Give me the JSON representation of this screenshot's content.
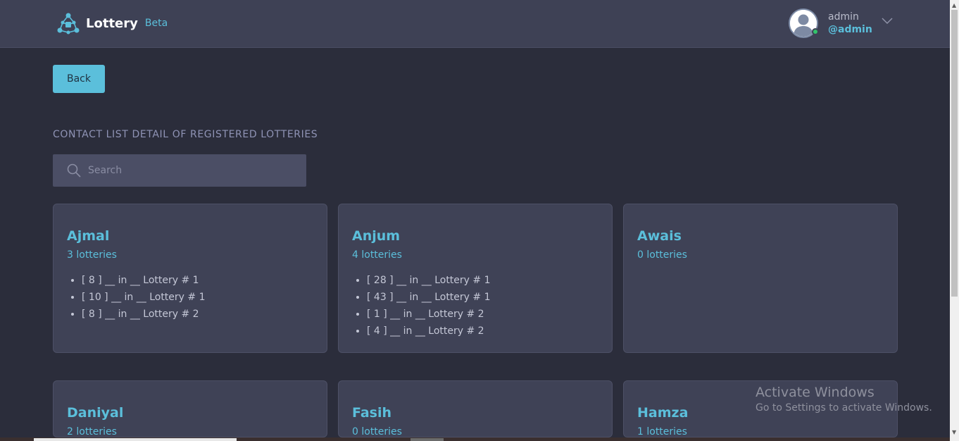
{
  "header": {
    "brand_name": "Lottery",
    "brand_badge": "Beta",
    "logo_icon": "network-logo-icon",
    "user": {
      "name": "admin",
      "handle": "@admin",
      "status": "online"
    }
  },
  "back_label": "Back",
  "section_title": "CONTACT LIST DETAIL OF REGISTERED LOTTERIES",
  "search": {
    "placeholder": "Search",
    "value": ""
  },
  "contacts": [
    {
      "name": "Ajmal",
      "count": "3 lotteries",
      "items": [
        "[ 8 ] __ in __ Lottery # 1",
        "[ 10 ] __ in __ Lottery # 1",
        "[ 8 ] __ in __ Lottery # 2"
      ]
    },
    {
      "name": "Anjum",
      "count": "4 lotteries",
      "items": [
        "[ 28 ] __ in __ Lottery # 1",
        "[ 43 ] __ in __ Lottery # 1",
        "[ 1 ] __ in __ Lottery # 2",
        "[ 4 ] __ in __ Lottery # 2"
      ]
    },
    {
      "name": "Awais",
      "count": "0 lotteries",
      "items": []
    },
    {
      "name": "Daniyal",
      "count": "2 lotteries",
      "items": []
    },
    {
      "name": "Fasih",
      "count": "0 lotteries",
      "items": []
    },
    {
      "name": "Hamza",
      "count": "1 lotteries",
      "items": []
    }
  ],
  "watermark": {
    "title": "Activate Windows",
    "subtitle": "Go to Settings to activate Windows."
  },
  "colors": {
    "accent": "#5bbfdb",
    "background": "#2b2d3b",
    "card": "#3f4256",
    "topbar": "#3e4155",
    "online": "#32c46b"
  }
}
